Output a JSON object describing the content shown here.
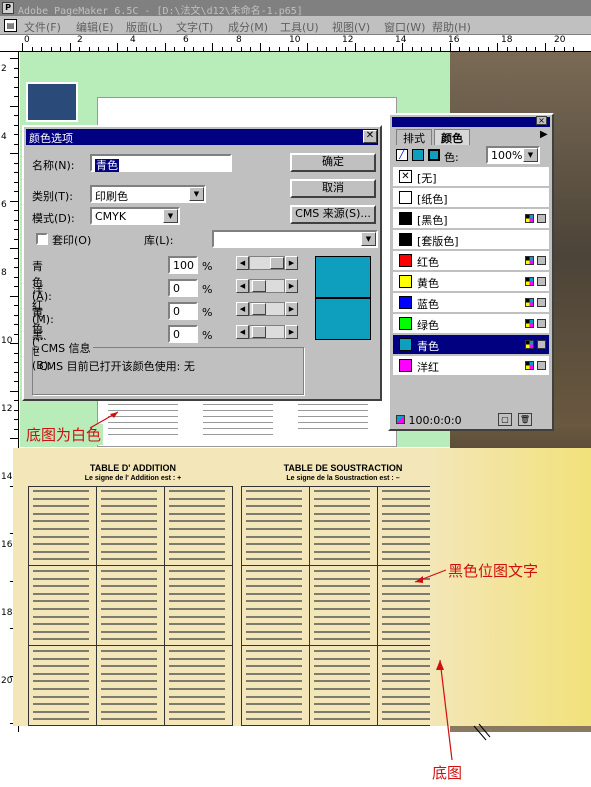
{
  "window": {
    "title": "Adobe PageMaker 6.5C - [D:\\法文\\d12\\未命名-1.p65]"
  },
  "menu": [
    "文件(F)",
    "编辑(E)",
    "版面(L)",
    "文字(T)",
    "成分(M)",
    "工具(U)",
    "视图(V)",
    "窗口(W)",
    "帮助(H)"
  ],
  "ruler_top": [
    "0",
    "2",
    "4",
    "6",
    "8",
    "10",
    "12",
    "14",
    "16",
    "18",
    "20"
  ],
  "ruler_left": [
    "2",
    "4",
    "6",
    "8",
    "10",
    "12",
    "14",
    "16",
    "18",
    "20"
  ],
  "dialog": {
    "title": "颜色选项",
    "name_label": "名称(N):",
    "name_value": "青色",
    "type_label": "类别(T):",
    "type_value": "印刷色",
    "model_label": "模式(D):",
    "model_value": "CMYK",
    "overprint_label": "套印(O)",
    "library_label": "库(L):",
    "library_value": "",
    "ok": "确定",
    "cancel": "取消",
    "cms_source": "CMS 来源(S)...",
    "sliders": [
      {
        "label": "青色(A):",
        "value": "100",
        "unit": "%"
      },
      {
        "label": "洋红(M):",
        "value": "0",
        "unit": "%"
      },
      {
        "label": "黄色(Y):",
        "value": "0",
        "unit": "%"
      },
      {
        "label": "黑色(B):",
        "value": "0",
        "unit": "%"
      }
    ],
    "cms_group": "CMS 信息",
    "cms_text": "CMS 目前已打开该颜色使用: 无"
  },
  "palette": {
    "tabs": [
      "排式",
      "颜色"
    ],
    "tint_label": "色:",
    "tint_value": "100%",
    "items": [
      {
        "name": "[无]",
        "color": "#ffffff",
        "none": true
      },
      {
        "name": "[纸色]",
        "color": "#ffffff"
      },
      {
        "name": "[黑色]",
        "color": "#000000",
        "icons": true
      },
      {
        "name": "[套版色]",
        "color": "#000000"
      },
      {
        "name": "红色",
        "color": "#ff0000",
        "icons": true
      },
      {
        "name": "黄色",
        "color": "#ffff00",
        "icons": true
      },
      {
        "name": "蓝色",
        "color": "#0000ff",
        "icons": true
      },
      {
        "name": "绿色",
        "color": "#00ff00",
        "icons": true
      },
      {
        "name": "青色",
        "color": "#0e9fbf",
        "icons": true,
        "selected": true
      },
      {
        "name": "洋红",
        "color": "#ff00ff",
        "icons": true
      }
    ],
    "status": "100:0:0:0"
  },
  "worksheet": {
    "add_title": "TABLE D' ADDITION",
    "add_sub": "Le signe de l' Addition est : +",
    "sub_title": "TABLE DE SOUSTRACTION",
    "sub_sub": "Le signe de la Soustraction est : –"
  },
  "annotations": {
    "white_bg": "底图为白色",
    "black_text": "黑色位图文字",
    "base": "底图"
  },
  "colors": {
    "dialog_title": "#000080",
    "cyan": "#0e9fbf",
    "annotation": "#d01010",
    "pasteboard": "#b8ecb8"
  }
}
